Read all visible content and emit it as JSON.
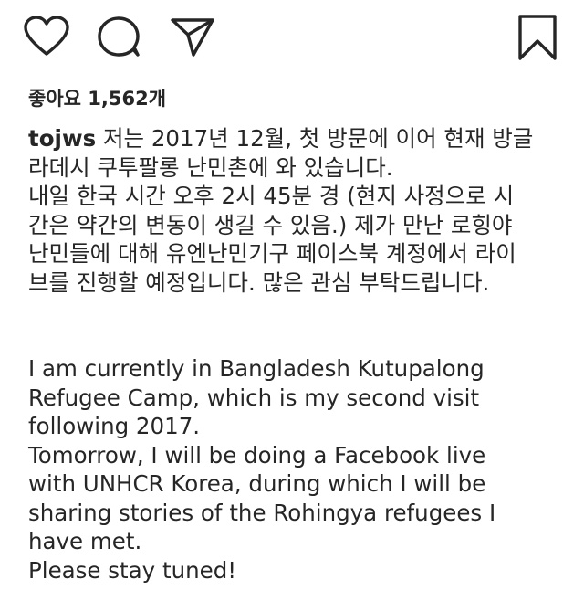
{
  "post": {
    "likes_label": "좋아요 1,562개",
    "username": "tojws",
    "caption": {
      "korean_first_line": " 저는 2017년 12월, 첫 방문에 이어 현재 방글",
      "korean_lines": [
        "라데시 쿠투팔롱 난민촌에 와 있습니다.",
        "내일 한국 시간 오후 2시 45분 경 (현지 사정으로 시",
        "간은 약간의 변동이 생길 수 있음.) 제가 만난 로힝야",
        "난민들에 대해 유엔난민기구 페이스북 계정에서 라이",
        "브를 진행할 예정입니다. 많은 관심 부탁드립니다."
      ],
      "english_lines": [
        "I am currently in Bangladesh Kutupalong",
        "Refugee Camp, which is my second visit",
        "following 2017.",
        "Tomorrow, I will be doing a Facebook live",
        "with UNHCR Korea, during which I will be",
        "sharing stories of the Rohingya refugees I",
        "have met.",
        "Please stay tuned!"
      ]
    }
  },
  "icons": {
    "like": "heart-outline",
    "comment": "speech-bubble-outline",
    "share": "paper-plane-outline",
    "save": "bookmark-outline"
  }
}
